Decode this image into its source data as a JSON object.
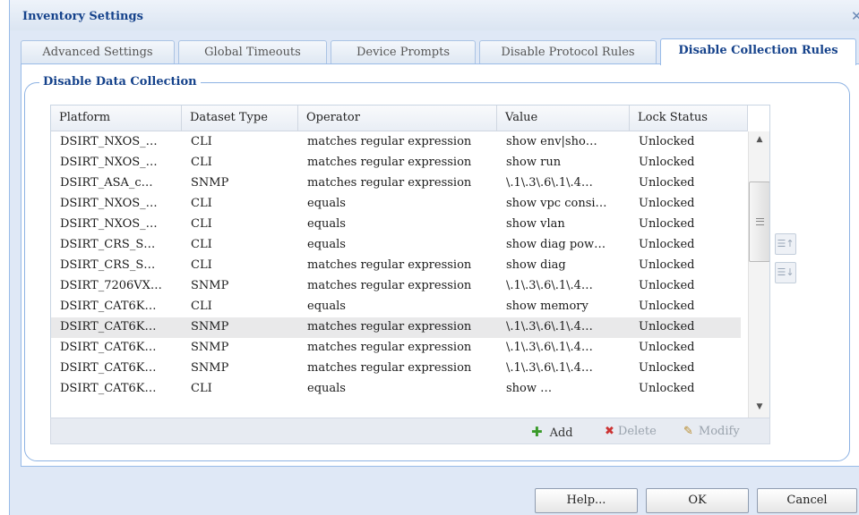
{
  "window": {
    "title": "Inventory Settings",
    "close_icon": "close-icon"
  },
  "tabs": [
    {
      "label": "Advanced Settings",
      "active": false
    },
    {
      "label": "Global Timeouts",
      "active": false
    },
    {
      "label": "Device Prompts",
      "active": false
    },
    {
      "label": "Disable Protocol Rules",
      "active": false
    },
    {
      "label": "Disable Collection Rules",
      "active": true
    }
  ],
  "fieldset": {
    "legend": "Disable Data Collection"
  },
  "grid": {
    "columns": [
      "Platform",
      "Dataset Type",
      "Operator",
      "Value",
      "Lock Status"
    ],
    "rows": [
      [
        "DSIRT_NXOS_…",
        "CLI",
        "matches regular expression",
        "show env|sho…",
        "Unlocked"
      ],
      [
        "DSIRT_NXOS_…",
        "CLI",
        "matches regular expression",
        "show run",
        "Unlocked"
      ],
      [
        "DSIRT_ASA_c…",
        "SNMP",
        "matches regular expression",
        "\\.1\\.3\\.6\\.1\\.4…",
        "Unlocked"
      ],
      [
        "DSIRT_NXOS_…",
        "CLI",
        "equals",
        "show vpc consi…",
        "Unlocked"
      ],
      [
        "DSIRT_NXOS_…",
        "CLI",
        "equals",
        "show vlan",
        "Unlocked"
      ],
      [
        "DSIRT_CRS_S…",
        "CLI",
        "equals",
        "show diag pow…",
        "Unlocked"
      ],
      [
        "DSIRT_CRS_S…",
        "CLI",
        "matches regular expression",
        "show diag",
        "Unlocked"
      ],
      [
        "DSIRT_7206VX…",
        "SNMP",
        "matches regular expression",
        "\\.1\\.3\\.6\\.1\\.4…",
        "Unlocked"
      ],
      [
        "DSIRT_CAT6K…",
        "CLI",
        "equals",
        "show memory",
        "Unlocked"
      ],
      [
        "DSIRT_CAT6K…",
        "SNMP",
        "matches regular expression",
        "\\.1\\.3\\.6\\.1\\.4…",
        "Unlocked"
      ],
      [
        "DSIRT_CAT6K…",
        "SNMP",
        "matches regular expression",
        "\\.1\\.3\\.6\\.1\\.4…",
        "Unlocked"
      ],
      [
        "DSIRT_CAT6K…",
        "SNMP",
        "matches regular expression",
        "\\.1\\.3\\.6\\.1\\.4…",
        "Unlocked"
      ],
      [
        "DSIRT_CAT6K…",
        "CLI",
        "equals",
        "show …",
        "Unlocked"
      ]
    ],
    "selected_row": 9
  },
  "toolbar": {
    "add_label": "Add",
    "delete_label": "Delete",
    "modify_label": "Modify",
    "add_icon": "add-icon",
    "delete_icon": "delete-icon",
    "modify_icon": "pencil-icon"
  },
  "move_buttons": {
    "up_icon": "move-up-icon",
    "down_icon": "move-down-icon"
  },
  "buttons": {
    "help": "Help...",
    "ok": "OK",
    "cancel": "Cancel"
  },
  "colors": {
    "title": "#15428b",
    "frame": "#99bbe8",
    "add_icon": "#3a9a2a",
    "delete_icon": "#cc3333",
    "selected_row": "#e9e9ea"
  }
}
